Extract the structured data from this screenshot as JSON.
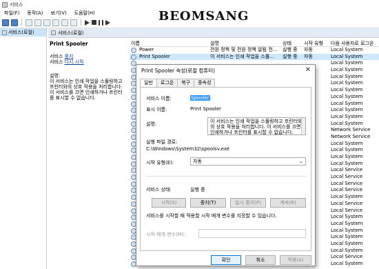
{
  "window": {
    "title": "서비스"
  },
  "menu": [
    "파일(F)",
    "동작(A)",
    "보기(V)",
    "도움말(H)"
  ],
  "logo": "BEOMSANG",
  "tree": {
    "item": "서비스(로컬)"
  },
  "header": {
    "title": "서비스(로컬)"
  },
  "desc": {
    "service_name": "Print Spooler",
    "action1_prefix": "서비스 ",
    "action1_link": "중지",
    "action2_prefix": "서비스 ",
    "action2_link": "다시 시작",
    "desc_label": "설명:",
    "desc_text": [
      "이 서비스는 인쇄 작업을 스풀링하고",
      "프린터와의 상호 작용을 처리합니다.",
      "이 서비스를 끄면 인쇄하거나 프린터",
      "를 표시할 수 없습니다."
    ]
  },
  "list": {
    "columns": {
      "name": "이름",
      "desc": "설명",
      "status": "상태",
      "startup": "시작 유형",
      "logon": "다음 사용자로 로그온"
    },
    "rows": [
      {
        "name": "Power",
        "desc": "전원 정책 및 전원 정책 알림 전...",
        "status": "실행 중",
        "startup": "자동",
        "logon": "Local System"
      },
      {
        "name": "Print Spooler",
        "desc": "이 서비스는 인쇄 작업을 스풀...",
        "status": "실행 중",
        "startup": "자동",
        "logon": "Local System"
      },
      {
        "name": "",
        "desc": "",
        "status": "",
        "startup": "",
        "logon": "Local System"
      },
      {
        "name": "",
        "desc": "",
        "status": "",
        "startup": "",
        "logon": "Local System"
      },
      {
        "name": "",
        "desc": "",
        "status": "",
        "startup": "",
        "logon": "Local System"
      },
      {
        "name": "",
        "desc": "",
        "status": "",
        "startup": "",
        "logon": "Local System"
      },
      {
        "name": "",
        "desc": "",
        "status": "",
        "startup": "",
        "logon": "Local System"
      },
      {
        "name": "",
        "desc": "",
        "status": "",
        "startup": "",
        "logon": "Local System"
      },
      {
        "name": "",
        "desc": "",
        "status": "",
        "startup": "",
        "logon": "Local System"
      },
      {
        "name": "",
        "desc": "",
        "status": "",
        "startup": "",
        "logon": "Local System"
      },
      {
        "name": "",
        "desc": "",
        "status": "",
        "startup": "",
        "logon": "Local System"
      },
      {
        "name": "",
        "desc": "",
        "status": "",
        "startup": "",
        "logon": "Local System"
      },
      {
        "name": "",
        "desc": "",
        "status": "",
        "startup": "",
        "logon": "Network Service"
      },
      {
        "name": "",
        "desc": "",
        "status": "",
        "startup": "",
        "logon": "Network Service"
      },
      {
        "name": "",
        "desc": "",
        "status": "",
        "startup": "",
        "logon": "Local System"
      },
      {
        "name": "",
        "desc": "",
        "status": "",
        "startup": "",
        "logon": "Local System"
      },
      {
        "name": "",
        "desc": "",
        "status": "",
        "startup": "",
        "logon": "Local System"
      },
      {
        "name": "",
        "desc": "",
        "status": "",
        "startup": "",
        "logon": "Local System"
      },
      {
        "name": "",
        "desc": "",
        "status": "",
        "startup": "",
        "logon": "Local Service"
      },
      {
        "name": "",
        "desc": "",
        "status": "",
        "startup": "",
        "logon": "Local Service"
      },
      {
        "name": "",
        "desc": "",
        "status": "",
        "startup": "",
        "logon": "Local Service"
      },
      {
        "name": "",
        "desc": "",
        "status": "",
        "startup": "",
        "logon": "Local Service"
      },
      {
        "name": "",
        "desc": "",
        "status": "",
        "startup": "",
        "logon": "Local System"
      },
      {
        "name": "",
        "desc": "",
        "status": "",
        "startup": "",
        "logon": "Local Service"
      },
      {
        "name": "",
        "desc": "",
        "status": "",
        "startup": "",
        "logon": "Local Service"
      },
      {
        "name": "",
        "desc": "",
        "status": "",
        "startup": "",
        "logon": "Local System"
      },
      {
        "name": "",
        "desc": "",
        "status": "",
        "startup": "",
        "logon": "Local System"
      },
      {
        "name": "",
        "desc": "",
        "status": "",
        "startup": "",
        "logon": "Local System"
      },
      {
        "name": "",
        "desc": "",
        "status": "",
        "startup": "",
        "logon": "Local System"
      },
      {
        "name": "",
        "desc": "",
        "status": "",
        "startup": "",
        "logon": "Local System"
      },
      {
        "name": "",
        "desc": "",
        "status": "",
        "startup": "",
        "logon": "Local System"
      },
      {
        "name": "",
        "desc": "",
        "status": "",
        "startup": "",
        "logon": "Local Service"
      },
      {
        "name": "",
        "desc": "",
        "status": "",
        "startup": "",
        "logon": "Local System"
      }
    ]
  },
  "dialog": {
    "title": "Print Spooler 속성(로컬 컴퓨터)",
    "close": "✕",
    "tabs": [
      "일반",
      "로그온",
      "복구",
      "종속성"
    ],
    "service_name_label": "서비스 이름:",
    "service_name_value": "Spooler",
    "display_name_label": "표시 이름:",
    "display_name_value": "Print Spooler",
    "desc_label": "설명:",
    "desc_text": "이 서비스는 인쇄 작업을 스풀링하고 프린터와의 상호 작용을 처리합니다. 이 서비스를 끄면 인쇄하거나 프린터를 표시할 수 없습니다.",
    "exe_label": "실행 파일 경로:",
    "exe_value": "C:\\Windows\\System32\\spoolsv.exe",
    "startup_label": "시작 유형(E):",
    "startup_value": "자동",
    "status_label": "서비스 상태:",
    "status_value": "실행 중",
    "btn_start": "시작(S)",
    "btn_stop": "중지(T)",
    "btn_pause": "일시 중지(P)",
    "btn_resume": "계속(R)",
    "param_note": "서비스를 시작할 때 적용할 시작 매개 변수를 지정할 수 있습니다.",
    "param_label": "시작 매개 변수(M):",
    "btn_ok": "확인",
    "btn_cancel": "취소",
    "btn_apply": "적용(A)"
  }
}
